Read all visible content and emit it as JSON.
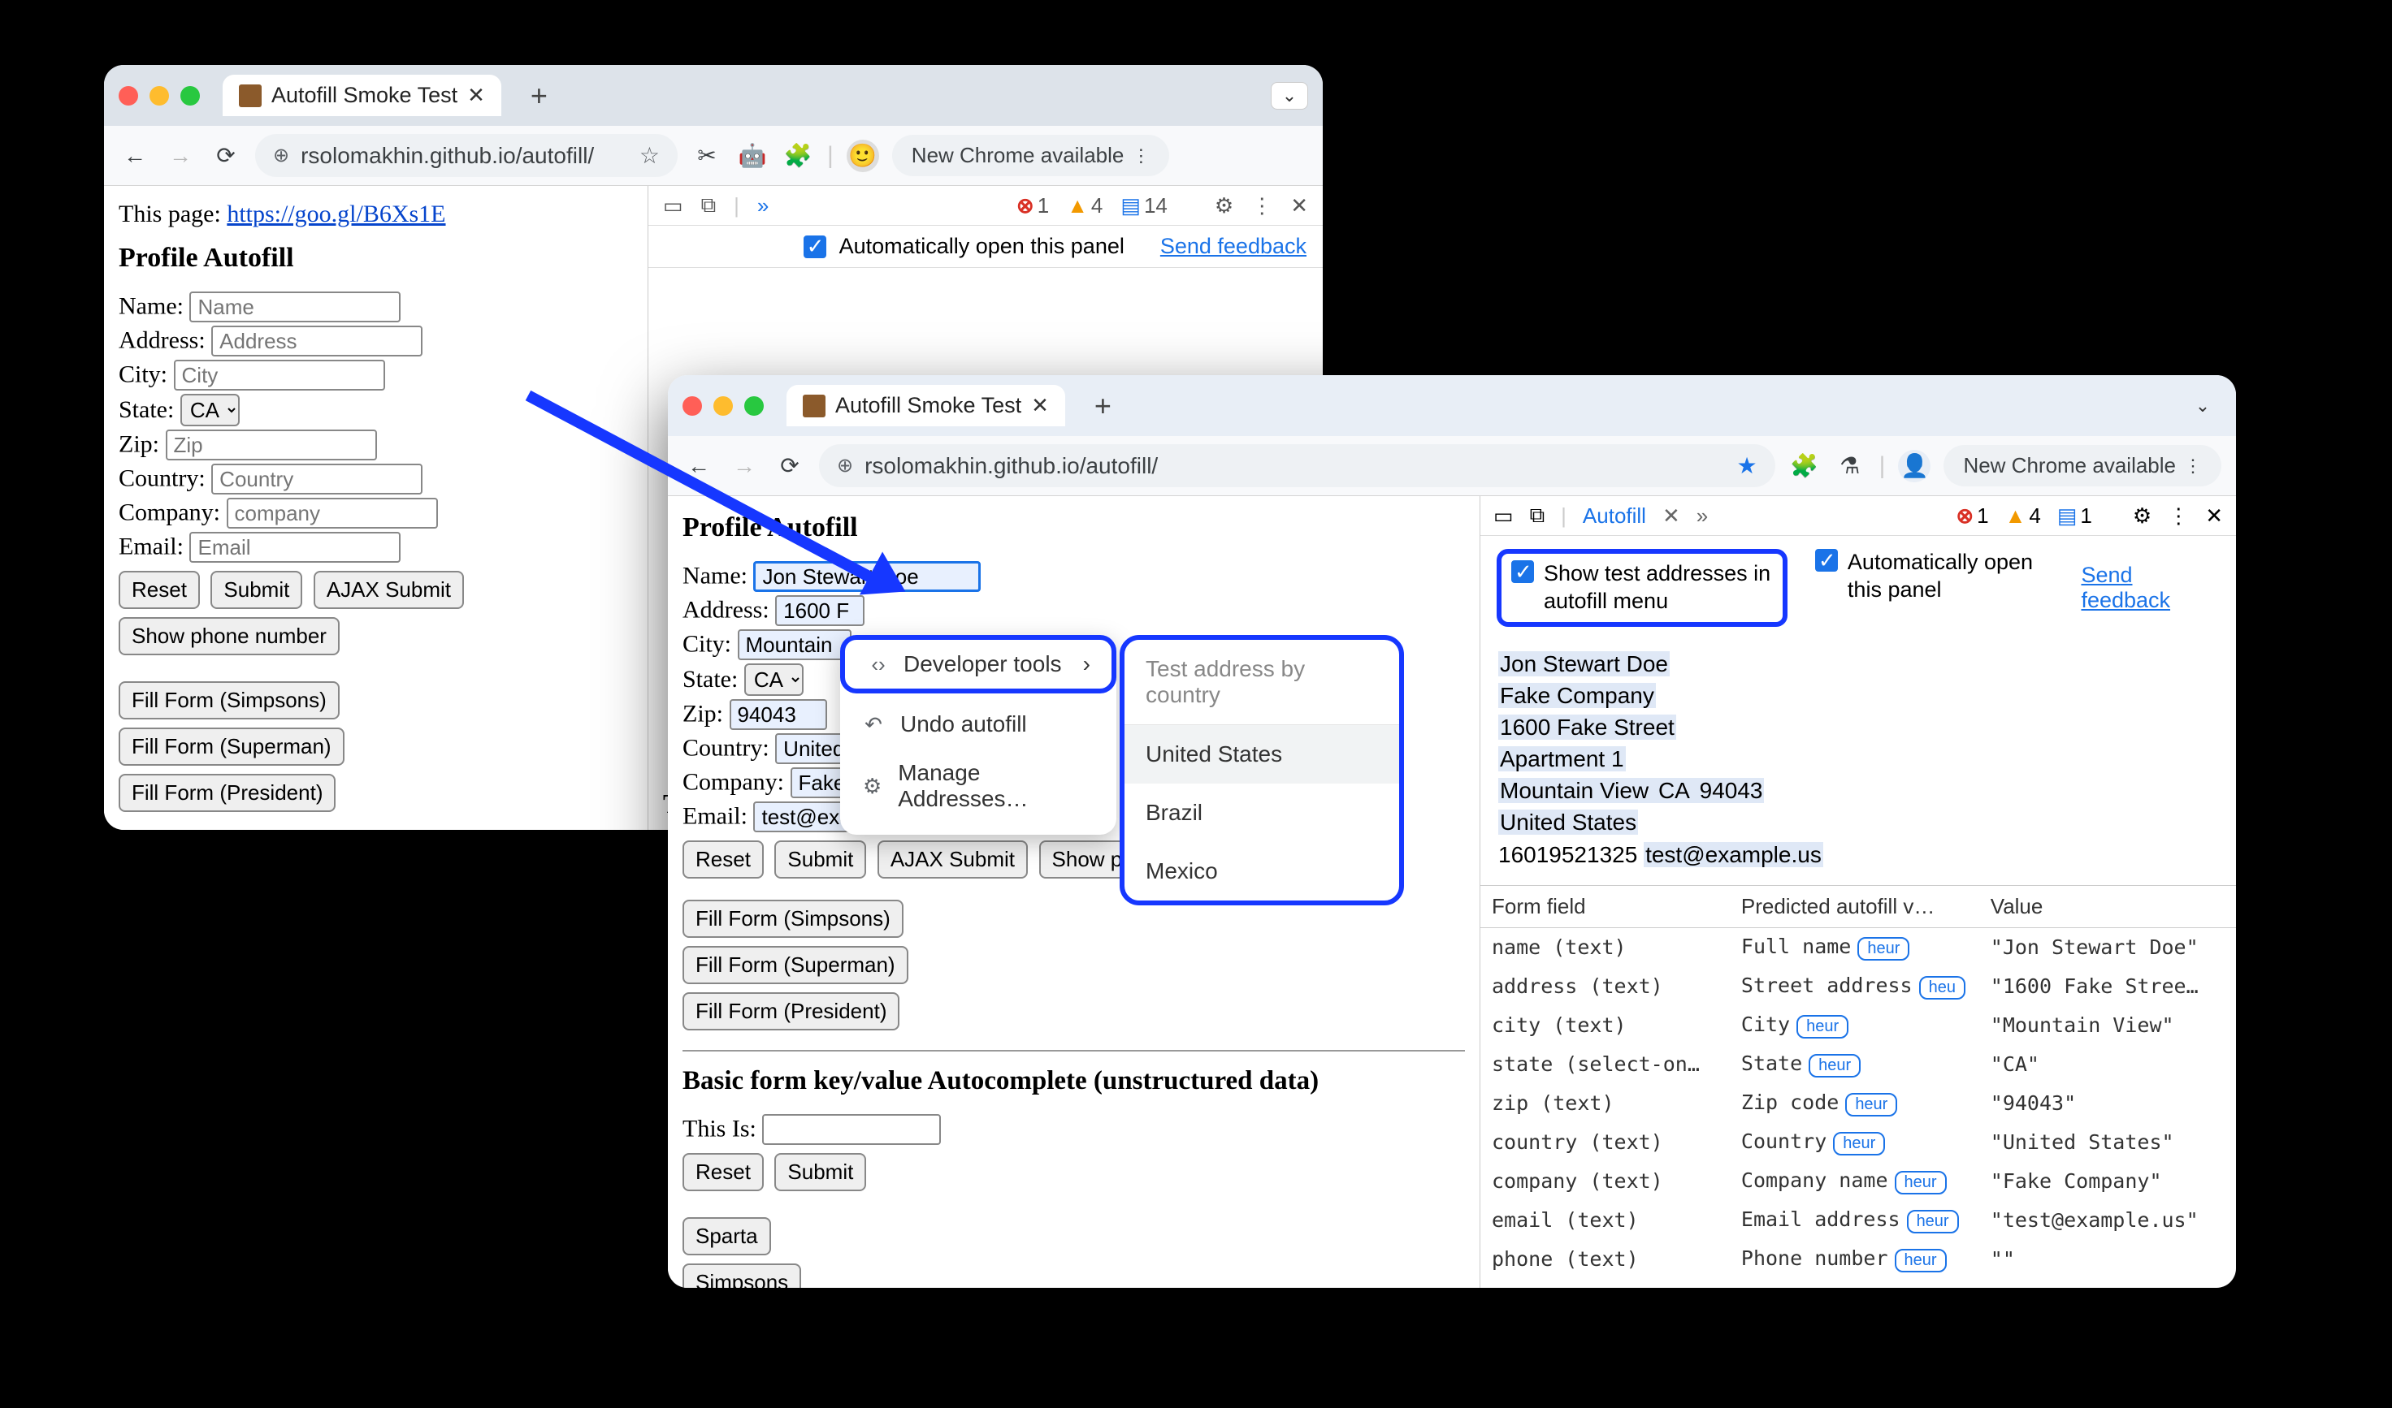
{
  "win1": {
    "tab_title": "Autofill Smoke Test",
    "url": "rsolomakhin.github.io/autofill/",
    "update_btn": "New Chrome available",
    "page_label": "This page: ",
    "page_link": "https://goo.gl/B6Xs1E",
    "heading": "Profile Autofill",
    "fields": {
      "name": "Name:",
      "name_ph": "Name",
      "address": "Address:",
      "address_ph": "Address",
      "city": "City:",
      "city_ph": "City",
      "state": "State:",
      "state_val": "CA",
      "zip": "Zip:",
      "zip_ph": "Zip",
      "country": "Country:",
      "country_ph": "Country",
      "company": "Company:",
      "company_ph": "company",
      "email": "Email:",
      "email_ph": "Email"
    },
    "buttons": {
      "reset": "Reset",
      "submit": "Submit",
      "ajax": "AJAX Submit",
      "show_phone": "Show phone number",
      "fill1": "Fill Form (Simpsons)",
      "fill2": "Fill Form (Superman)",
      "fill3": "Fill Form (President)"
    },
    "dt": {
      "errors": "1",
      "warnings": "4",
      "msgs": "14",
      "auto_open": "Automatically open this panel",
      "feedback": "Send feedback",
      "truncated": "Te"
    }
  },
  "win2": {
    "tab_title": "Autofill Smoke Test",
    "url": "rsolomakhin.github.io/autofill/",
    "update_btn": "New Chrome available",
    "heading": "Profile Autofill",
    "fields": {
      "name": "Name:",
      "name_val": "Jon Stewart Doe",
      "address": "Address:",
      "address_val": "1600 F",
      "city": "City:",
      "city_val": "Mountain",
      "state": "State:",
      "state_val": "CA",
      "zip": "Zip:",
      "zip_val": "94043",
      "country": "Country:",
      "country_val": "United",
      "company": "Company:",
      "company_val": "Fake",
      "email": "Email:",
      "email_val": "test@example.us"
    },
    "buttons": {
      "reset": "Reset",
      "submit": "Submit",
      "ajax": "AJAX Submit",
      "show_phone": "Show ph",
      "fill1": "Fill Form (Simpsons)",
      "fill2": "Fill Form (Superman)",
      "fill3": "Fill Form (President)"
    },
    "section2_heading": "Basic form key/value Autocomplete (unstructured data)",
    "thisis": "This Is:",
    "reset2": "Reset",
    "submit2": "Submit",
    "sparta": "Sparta",
    "simpsons": "Simpsons",
    "ctx": {
      "dev_tools": "Developer tools",
      "undo": "Undo autofill",
      "manage": "Manage Addresses…",
      "country_hdr": "Test address by country",
      "c1": "United States",
      "c2": "Brazil",
      "c3": "Mexico"
    },
    "dt": {
      "tab": "Autofill",
      "errors": "1",
      "warnings": "4",
      "msgs": "1",
      "opt1": "Show test addresses in autofill menu",
      "opt2": "Automatically open this panel",
      "feedback": "Send feedback",
      "addr_lines": {
        "l1": "Jon Stewart Doe",
        "l2": "Fake Company",
        "l3": "1600 Fake Street",
        "l4": "Apartment 1",
        "l5a": "Mountain View ",
        "l5b": "CA",
        "l5c": " 94043",
        "l6": "United States",
        "l7a": "16019521325 ",
        "l7b": "test@example.us"
      },
      "table": {
        "h1": "Form field",
        "h2": "Predicted autofill v…",
        "h3": "Value",
        "rows": [
          {
            "f": "name (text)",
            "p": "Full name",
            "h": "heur",
            "v": "\"Jon Stewart Doe\""
          },
          {
            "f": "address (text)",
            "p": "Street address",
            "h": "heu",
            "v": "\"1600 Fake Stree…"
          },
          {
            "f": "city (text)",
            "p": "City",
            "h": "heur",
            "v": "\"Mountain View\""
          },
          {
            "f": "state (select-on…",
            "p": "State",
            "h": "heur",
            "v": "\"CA\""
          },
          {
            "f": "zip (text)",
            "p": "Zip code",
            "h": "heur",
            "v": "\"94043\""
          },
          {
            "f": "country (text)",
            "p": "Country",
            "h": "heur",
            "v": "\"United States\""
          },
          {
            "f": "company (text)",
            "p": "Company name",
            "h": "heur",
            "v": "\"Fake Company\""
          },
          {
            "f": "email (text)",
            "p": "Email address",
            "h": "heur",
            "v": "\"test@example.us\""
          },
          {
            "f": "phone (text)",
            "p": "Phone number",
            "h": "heur",
            "v": "\"\""
          }
        ]
      }
    }
  }
}
